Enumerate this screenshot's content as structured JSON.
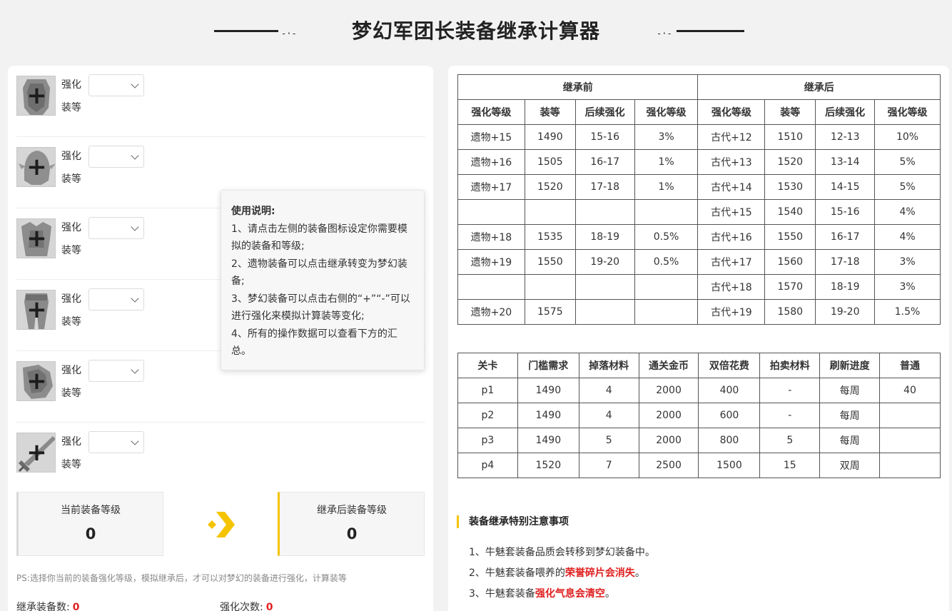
{
  "page_title": "梦幻军团长装备继承计算器",
  "title_deco": {
    "left_dash": "-·-",
    "right_dash": "-·-"
  },
  "equipment": {
    "enhance_label": "强化",
    "gear_label": "装等",
    "plus_glyph": "+",
    "items": [
      {
        "slot_icon": "shoulder-armor-icon",
        "select_value": ""
      },
      {
        "slot_icon": "helmet-icon",
        "select_value": ""
      },
      {
        "slot_icon": "chest-armor-icon",
        "select_value": ""
      },
      {
        "slot_icon": "leg-armor-icon",
        "select_value": ""
      },
      {
        "slot_icon": "gauntlet-icon",
        "select_value": ""
      },
      {
        "slot_icon": "sword-icon",
        "select_value": ""
      }
    ]
  },
  "levels": {
    "current_label": "当前装备等级",
    "current_value": "0",
    "after_label": "继承后装备等级",
    "after_value": "0",
    "arrow_color": "#f5c400"
  },
  "ps_note": "PS:选择你当前的装备强化等级，模拟继承后，才可以对梦幻的装备进行强化，计算装等",
  "stats": {
    "inherit_count_label": "继承装备数:",
    "inherit_count_value": "0",
    "enhance_count_label": "强化次数:",
    "enhance_count_value": "0"
  },
  "tooltip": {
    "title": "使用说明:",
    "lines": [
      "1、请点击左侧的装备图标设定你需要模拟的装备和等级;",
      "2、遗物装备可以点击继承转变为梦幻装备;",
      "3、梦幻装备可以点击右侧的“+”“-”可以进行强化来模拟计算装等变化;",
      "4、所有的操作数据可以查看下方的汇总。"
    ]
  },
  "inherit_table": {
    "group_before": "继承前",
    "group_after": "继承后",
    "headers": [
      "强化等级",
      "装等",
      "后续强化",
      "强化等级",
      "强化等级",
      "装等",
      "后续强化",
      "强化等级"
    ],
    "rows": [
      [
        "遗物+15",
        "1490",
        "15-16",
        "3%",
        "古代+12",
        "1510",
        "12-13",
        "10%"
      ],
      [
        "遗物+16",
        "1505",
        "16-17",
        "1%",
        "古代+13",
        "1520",
        "13-14",
        "5%"
      ],
      [
        "遗物+17",
        "1520",
        "17-18",
        "1%",
        "古代+14",
        "1530",
        "14-15",
        "5%"
      ],
      [
        "",
        "",
        "",
        "",
        "古代+15",
        "1540",
        "15-16",
        "4%"
      ],
      [
        "遗物+18",
        "1535",
        "18-19",
        "0.5%",
        "古代+16",
        "1550",
        "16-17",
        "4%"
      ],
      [
        "遗物+19",
        "1550",
        "19-20",
        "0.5%",
        "古代+17",
        "1560",
        "17-18",
        "3%"
      ],
      [
        "",
        "",
        "",
        "",
        "古代+18",
        "1570",
        "18-19",
        "3%"
      ],
      [
        "遗物+20",
        "1575",
        "",
        "",
        "古代+19",
        "1580",
        "19-20",
        "1.5%"
      ]
    ]
  },
  "stage_table": {
    "headers": [
      "关卡",
      "门槛需求",
      "掉落材料",
      "通关金币",
      "双倍花费",
      "拍卖材料",
      "刷新进度",
      "普通"
    ],
    "rows": [
      [
        "p1",
        "1490",
        "4",
        "2000",
        "400",
        "-",
        "每周",
        "40"
      ],
      [
        "p2",
        "1490",
        "4",
        "2000",
        "600",
        "-",
        "每周",
        ""
      ],
      [
        "p3",
        "1490",
        "5",
        "2000",
        "800",
        "5",
        "每周",
        ""
      ],
      [
        "p4",
        "1520",
        "7",
        "2500",
        "1500",
        "15",
        "双周",
        ""
      ]
    ]
  },
  "notice": {
    "title": "装备继承特别注意事项",
    "item1": "1、牛魅套装备品质会转移到梦幻装备中。",
    "item2_prefix": "2、牛魅套装备喂养的",
    "item2_highlight": "荣誉碎片会消失",
    "item2_suffix": "。",
    "item3_prefix": "3、牛魅套装备",
    "item3_highlight": "强化气息会清空",
    "item3_suffix": "。"
  },
  "colors": {
    "accent_yellow": "#f5c400",
    "alert_red": "#e02020",
    "background": "#f2f2f2"
  }
}
